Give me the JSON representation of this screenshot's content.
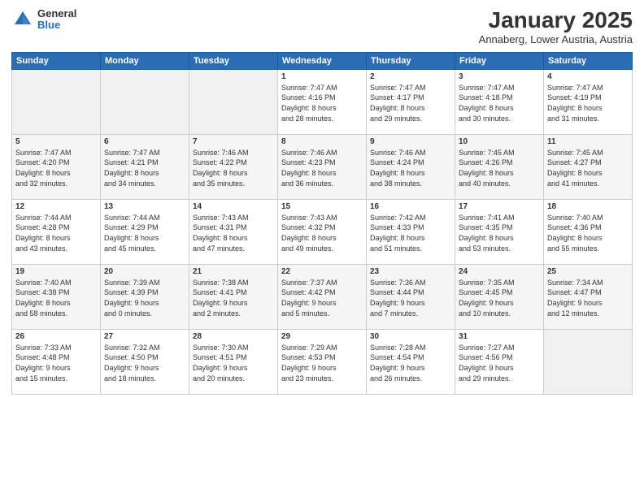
{
  "logo": {
    "general": "General",
    "blue": "Blue"
  },
  "title": "January 2025",
  "subtitle": "Annaberg, Lower Austria, Austria",
  "headers": [
    "Sunday",
    "Monday",
    "Tuesday",
    "Wednesday",
    "Thursday",
    "Friday",
    "Saturday"
  ],
  "weeks": [
    [
      {
        "day": "",
        "info": ""
      },
      {
        "day": "",
        "info": ""
      },
      {
        "day": "",
        "info": ""
      },
      {
        "day": "1",
        "info": "Sunrise: 7:47 AM\nSunset: 4:16 PM\nDaylight: 8 hours\nand 28 minutes."
      },
      {
        "day": "2",
        "info": "Sunrise: 7:47 AM\nSunset: 4:17 PM\nDaylight: 8 hours\nand 29 minutes."
      },
      {
        "day": "3",
        "info": "Sunrise: 7:47 AM\nSunset: 4:18 PM\nDaylight: 8 hours\nand 30 minutes."
      },
      {
        "day": "4",
        "info": "Sunrise: 7:47 AM\nSunset: 4:19 PM\nDaylight: 8 hours\nand 31 minutes."
      }
    ],
    [
      {
        "day": "5",
        "info": "Sunrise: 7:47 AM\nSunset: 4:20 PM\nDaylight: 8 hours\nand 32 minutes."
      },
      {
        "day": "6",
        "info": "Sunrise: 7:47 AM\nSunset: 4:21 PM\nDaylight: 8 hours\nand 34 minutes."
      },
      {
        "day": "7",
        "info": "Sunrise: 7:46 AM\nSunset: 4:22 PM\nDaylight: 8 hours\nand 35 minutes."
      },
      {
        "day": "8",
        "info": "Sunrise: 7:46 AM\nSunset: 4:23 PM\nDaylight: 8 hours\nand 36 minutes."
      },
      {
        "day": "9",
        "info": "Sunrise: 7:46 AM\nSunset: 4:24 PM\nDaylight: 8 hours\nand 38 minutes."
      },
      {
        "day": "10",
        "info": "Sunrise: 7:45 AM\nSunset: 4:26 PM\nDaylight: 8 hours\nand 40 minutes."
      },
      {
        "day": "11",
        "info": "Sunrise: 7:45 AM\nSunset: 4:27 PM\nDaylight: 8 hours\nand 41 minutes."
      }
    ],
    [
      {
        "day": "12",
        "info": "Sunrise: 7:44 AM\nSunset: 4:28 PM\nDaylight: 8 hours\nand 43 minutes."
      },
      {
        "day": "13",
        "info": "Sunrise: 7:44 AM\nSunset: 4:29 PM\nDaylight: 8 hours\nand 45 minutes."
      },
      {
        "day": "14",
        "info": "Sunrise: 7:43 AM\nSunset: 4:31 PM\nDaylight: 8 hours\nand 47 minutes."
      },
      {
        "day": "15",
        "info": "Sunrise: 7:43 AM\nSunset: 4:32 PM\nDaylight: 8 hours\nand 49 minutes."
      },
      {
        "day": "16",
        "info": "Sunrise: 7:42 AM\nSunset: 4:33 PM\nDaylight: 8 hours\nand 51 minutes."
      },
      {
        "day": "17",
        "info": "Sunrise: 7:41 AM\nSunset: 4:35 PM\nDaylight: 8 hours\nand 53 minutes."
      },
      {
        "day": "18",
        "info": "Sunrise: 7:40 AM\nSunset: 4:36 PM\nDaylight: 8 hours\nand 55 minutes."
      }
    ],
    [
      {
        "day": "19",
        "info": "Sunrise: 7:40 AM\nSunset: 4:38 PM\nDaylight: 8 hours\nand 58 minutes."
      },
      {
        "day": "20",
        "info": "Sunrise: 7:39 AM\nSunset: 4:39 PM\nDaylight: 9 hours\nand 0 minutes."
      },
      {
        "day": "21",
        "info": "Sunrise: 7:38 AM\nSunset: 4:41 PM\nDaylight: 9 hours\nand 2 minutes."
      },
      {
        "day": "22",
        "info": "Sunrise: 7:37 AM\nSunset: 4:42 PM\nDaylight: 9 hours\nand 5 minutes."
      },
      {
        "day": "23",
        "info": "Sunrise: 7:36 AM\nSunset: 4:44 PM\nDaylight: 9 hours\nand 7 minutes."
      },
      {
        "day": "24",
        "info": "Sunrise: 7:35 AM\nSunset: 4:45 PM\nDaylight: 9 hours\nand 10 minutes."
      },
      {
        "day": "25",
        "info": "Sunrise: 7:34 AM\nSunset: 4:47 PM\nDaylight: 9 hours\nand 12 minutes."
      }
    ],
    [
      {
        "day": "26",
        "info": "Sunrise: 7:33 AM\nSunset: 4:48 PM\nDaylight: 9 hours\nand 15 minutes."
      },
      {
        "day": "27",
        "info": "Sunrise: 7:32 AM\nSunset: 4:50 PM\nDaylight: 9 hours\nand 18 minutes."
      },
      {
        "day": "28",
        "info": "Sunrise: 7:30 AM\nSunset: 4:51 PM\nDaylight: 9 hours\nand 20 minutes."
      },
      {
        "day": "29",
        "info": "Sunrise: 7:29 AM\nSunset: 4:53 PM\nDaylight: 9 hours\nand 23 minutes."
      },
      {
        "day": "30",
        "info": "Sunrise: 7:28 AM\nSunset: 4:54 PM\nDaylight: 9 hours\nand 26 minutes."
      },
      {
        "day": "31",
        "info": "Sunrise: 7:27 AM\nSunset: 4:56 PM\nDaylight: 9 hours\nand 29 minutes."
      },
      {
        "day": "",
        "info": ""
      }
    ]
  ]
}
